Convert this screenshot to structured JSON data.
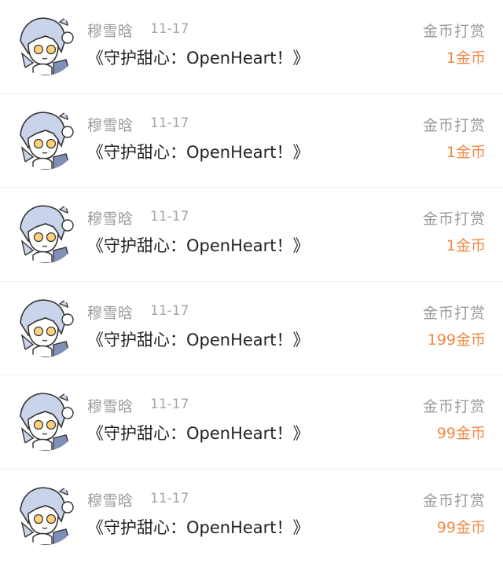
{
  "tips": [
    {
      "user": "穆雪晗",
      "date": "11-17",
      "title": "《守护甜心：OpenHeart！》",
      "type": "金币打赏",
      "amount": "1金币",
      "avatar": "anime-girl-avatar"
    },
    {
      "user": "穆雪晗",
      "date": "11-17",
      "title": "《守护甜心：OpenHeart！》",
      "type": "金币打赏",
      "amount": "1金币",
      "avatar": "anime-girl-avatar"
    },
    {
      "user": "穆雪晗",
      "date": "11-17",
      "title": "《守护甜心：OpenHeart！》",
      "type": "金币打赏",
      "amount": "1金币",
      "avatar": "anime-girl-avatar"
    },
    {
      "user": "穆雪晗",
      "date": "11-17",
      "title": "《守护甜心：OpenHeart！》",
      "type": "金币打赏",
      "amount": "199金币",
      "avatar": "anime-girl-avatar"
    },
    {
      "user": "穆雪晗",
      "date": "11-17",
      "title": "《守护甜心：OpenHeart！》",
      "type": "金币打赏",
      "amount": "99金币",
      "avatar": "anime-girl-avatar"
    },
    {
      "user": "穆雪晗",
      "date": "11-17",
      "title": "《守护甜心：OpenHeart！》",
      "type": "金币打赏",
      "amount": "99金币",
      "avatar": "anime-girl-avatar"
    }
  ],
  "colors": {
    "amount": "#f08a45",
    "muted": "#9a9a9a",
    "text": "#222222"
  }
}
